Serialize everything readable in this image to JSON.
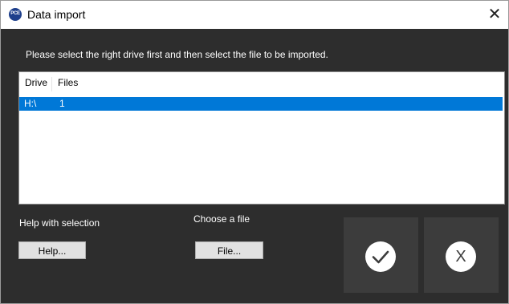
{
  "window": {
    "title": "Data import",
    "logo_text": "PCE",
    "close_glyph": "✕",
    "icon": "close-icon"
  },
  "instruction": "Please select the right drive first and then select the file to be imported.",
  "list": {
    "columns": [
      "Drive",
      "Files"
    ],
    "rows": [
      {
        "drive": "H:\\",
        "files": "1",
        "selected": true
      }
    ],
    "selection_color": "#0078d7"
  },
  "help": {
    "label": "Help with selection",
    "button": "Help..."
  },
  "file": {
    "label": "Choose a file",
    "button": "File..."
  },
  "actions": {
    "confirm_glyph": "✓",
    "cancel_glyph": "X",
    "confirm_icon": "checkmark-icon",
    "cancel_icon": "cancel-icon"
  },
  "colors": {
    "background": "#2d2d2d",
    "action_button": "#3c3c3c"
  }
}
